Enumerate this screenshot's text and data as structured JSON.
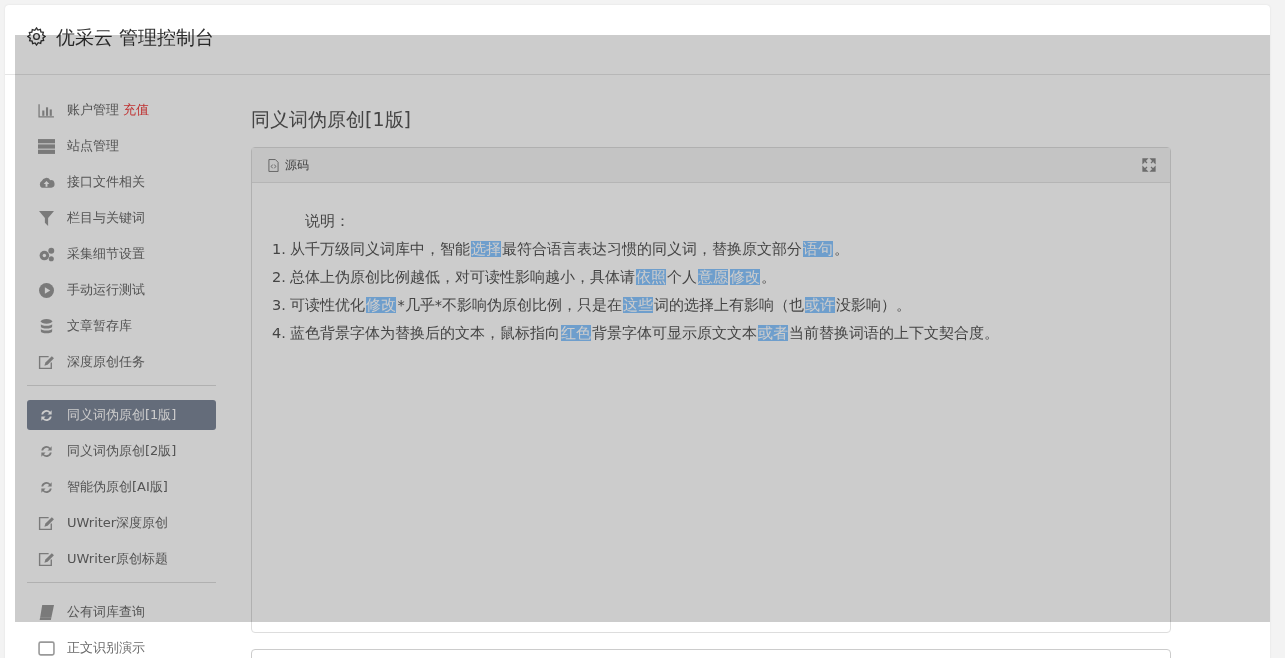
{
  "header": {
    "title": "优采云 管理控制台"
  },
  "sidebar": {
    "groups": [
      [
        {
          "kind": "bar-chart",
          "label": "账户管理",
          "badge": "充值",
          "selected": false
        },
        {
          "kind": "server",
          "label": "站点管理",
          "selected": false
        },
        {
          "kind": "cloud-upload",
          "label": "接口文件相关",
          "selected": false
        },
        {
          "kind": "filter",
          "label": "栏目与关键词",
          "selected": false
        },
        {
          "kind": "gears",
          "label": "采集细节设置",
          "selected": false
        },
        {
          "kind": "play",
          "label": "手动运行测试",
          "selected": false
        },
        {
          "kind": "database",
          "label": "文章暂存库",
          "selected": false
        },
        {
          "kind": "edit",
          "label": "深度原创任务",
          "selected": false
        }
      ],
      [
        {
          "kind": "refresh",
          "label": "同义词伪原创[1版]",
          "selected": true
        },
        {
          "kind": "refresh",
          "label": "同义词伪原创[2版]",
          "selected": false
        },
        {
          "kind": "refresh",
          "label": "智能伪原创[AI版]",
          "selected": false
        },
        {
          "kind": "edit",
          "label": "UWriter深度原创",
          "selected": false
        },
        {
          "kind": "edit",
          "label": "UWriter原创标题",
          "selected": false
        }
      ],
      [
        {
          "kind": "book",
          "label": "公有词库查询",
          "selected": false
        },
        {
          "kind": "square",
          "label": "正文识别演示",
          "selected": false
        }
      ]
    ]
  },
  "main": {
    "title": "同义词伪原创[1版]",
    "panel": {
      "tab": "源码",
      "lines": [
        {
          "kind": "heading",
          "segments": [
            {
              "text": "说明：",
              "highlighted": false
            }
          ]
        },
        {
          "kind": "item",
          "segments": [
            {
              "text": "1. 从千万级同义词库中，智能",
              "highlighted": false
            },
            {
              "text": "选择",
              "highlighted": true
            },
            {
              "text": "最符合语言表达习惯的同义词，替换原文部分",
              "highlighted": false
            },
            {
              "text": "语句",
              "highlighted": true
            },
            {
              "text": "。",
              "highlighted": false
            }
          ]
        },
        {
          "kind": "item",
          "segments": [
            {
              "text": "2. 总体上伪原创比例越低，对可读性影响越小，具体请",
              "highlighted": false
            },
            {
              "text": "依照",
              "highlighted": true
            },
            {
              "text": "个人",
              "highlighted": false
            },
            {
              "text": "意愿",
              "highlighted": true
            },
            {
              "text": "修改",
              "highlighted": true
            },
            {
              "text": "。",
              "highlighted": false
            }
          ]
        },
        {
          "kind": "item",
          "segments": [
            {
              "text": "3. 可读性优化",
              "highlighted": false
            },
            {
              "text": "修改",
              "highlighted": true
            },
            {
              "text": "*几乎*不影响伪原创比例，只是在",
              "highlighted": false
            },
            {
              "text": "这些",
              "highlighted": true
            },
            {
              "text": "词的选择上有影响（也",
              "highlighted": false
            },
            {
              "text": "或许",
              "highlighted": true
            },
            {
              "text": "没影响）。",
              "highlighted": false
            }
          ]
        },
        {
          "kind": "item",
          "segments": [
            {
              "text": "4. 蓝色背景字体为替换后的文本，鼠标指向",
              "highlighted": false
            },
            {
              "text": "红色",
              "highlighted": true
            },
            {
              "text": "背景字体可显示原文文本",
              "highlighted": false
            },
            {
              "text": "或者",
              "highlighted": true
            },
            {
              "text": "当前替换词语的上下文契合度。",
              "highlighted": false
            }
          ]
        }
      ]
    }
  },
  "overlay": {
    "visible": true
  }
}
